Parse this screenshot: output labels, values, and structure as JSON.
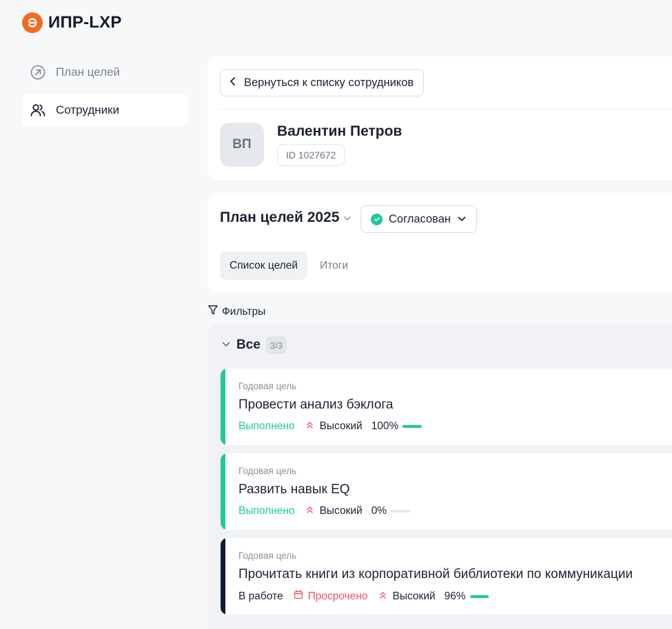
{
  "app": {
    "title": "ИПР-LXP"
  },
  "sidebar": {
    "items": [
      {
        "label": "План целей",
        "icon": "goal-arrow-icon",
        "active": false
      },
      {
        "label": "Сотрудники",
        "icon": "users-icon",
        "active": true
      }
    ]
  },
  "profile": {
    "back_label": "Вернуться к списку сотрудников",
    "initials": "ВП",
    "name": "Валентин Петров",
    "id_label": "ID 1027672"
  },
  "plan": {
    "title": "План целей 2025",
    "status": "Согласован",
    "tabs": [
      {
        "label": "Список целей",
        "active": true
      },
      {
        "label": "Итоги",
        "active": false
      }
    ]
  },
  "filters_label": "Фильтры",
  "group": {
    "title": "Все",
    "count": "3/3"
  },
  "goals": [
    {
      "kind": "Годовая цель",
      "title": "Провести анализ бэклога",
      "status": "Выполнено",
      "overdue": "",
      "priority": "Высокий",
      "progress_label": "100%",
      "progress": 1.0,
      "accent": "#1ec99b"
    },
    {
      "kind": "Годовая цель",
      "title": "Развить навык EQ",
      "status": "Выполнено",
      "overdue": "",
      "priority": "Высокий",
      "progress_label": "0%",
      "progress": 0.0,
      "accent": "#1ec99b"
    },
    {
      "kind": "Годовая цель",
      "title": "Прочитать книги из корпоративной библиотеки по коммуникации",
      "status": "В работе",
      "overdue": "Просрочено",
      "priority": "Высокий",
      "progress_label": "96%",
      "progress": 0.96,
      "accent": "#111a3a"
    }
  ],
  "colors": {
    "brand": "#f26b21",
    "success": "#1ec99b",
    "danger": "#f0515e",
    "in_progress_accent": "#111a3a"
  }
}
